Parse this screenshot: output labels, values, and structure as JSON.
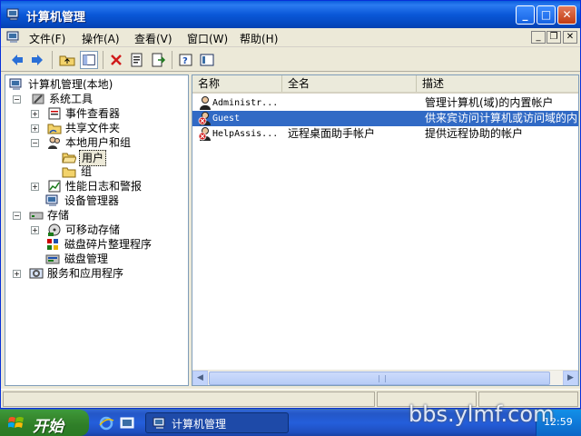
{
  "window": {
    "title": "计算机管理",
    "controls": {
      "minimize": "_",
      "maximize": "□",
      "close": "✕"
    }
  },
  "menubar": {
    "items": [
      "文件(F)",
      "操作(A)",
      "查看(V)",
      "窗口(W)",
      "帮助(H)"
    ],
    "mdi_controls": {
      "minimize": "_",
      "restore": "❐",
      "close": "✕"
    }
  },
  "toolbar": {
    "buttons": [
      "back-icon",
      "forward-icon",
      "up-folder-icon",
      "show-hide-tree-icon",
      "delete-icon",
      "properties-icon",
      "export-list-icon",
      "help-icon",
      "console-icon"
    ]
  },
  "tree": {
    "root": "计算机管理(本地)",
    "system_tools": "系统工具",
    "event_viewer": "事件查看器",
    "shared_folders": "共享文件夹",
    "local_users_groups": "本地用户和组",
    "users": "用户",
    "groups": "组",
    "perf_logs": "性能日志和警报",
    "device_manager": "设备管理器",
    "storage": "存储",
    "removable_storage": "可移动存储",
    "defrag": "磁盘碎片整理程序",
    "disk_management": "磁盘管理",
    "services_apps": "服务和应用程序"
  },
  "list": {
    "columns": [
      "名称",
      "全名",
      "描述"
    ],
    "rows": [
      {
        "name": "Administr...",
        "full_name": "",
        "description": "管理计算机(域)的内置帐户",
        "selected": false,
        "disabled": false
      },
      {
        "name": "Guest",
        "full_name": "",
        "description": "供来宾访问计算机或访问域的内",
        "selected": true,
        "disabled": true
      },
      {
        "name": "HelpAssis...",
        "full_name": "远程桌面助手帐户",
        "description": "提供远程协助的帐户",
        "selected": false,
        "disabled": true
      }
    ]
  },
  "taskbar": {
    "start_label": "开始",
    "task_button": "计算机管理",
    "clock": "12:59"
  },
  "watermark": "bbs.ylmf.com",
  "colors": {
    "titlebar": "#0a5ddb",
    "selection": "#316ac5",
    "start_button": "#3a8f32",
    "taskbar": "#245edb"
  }
}
